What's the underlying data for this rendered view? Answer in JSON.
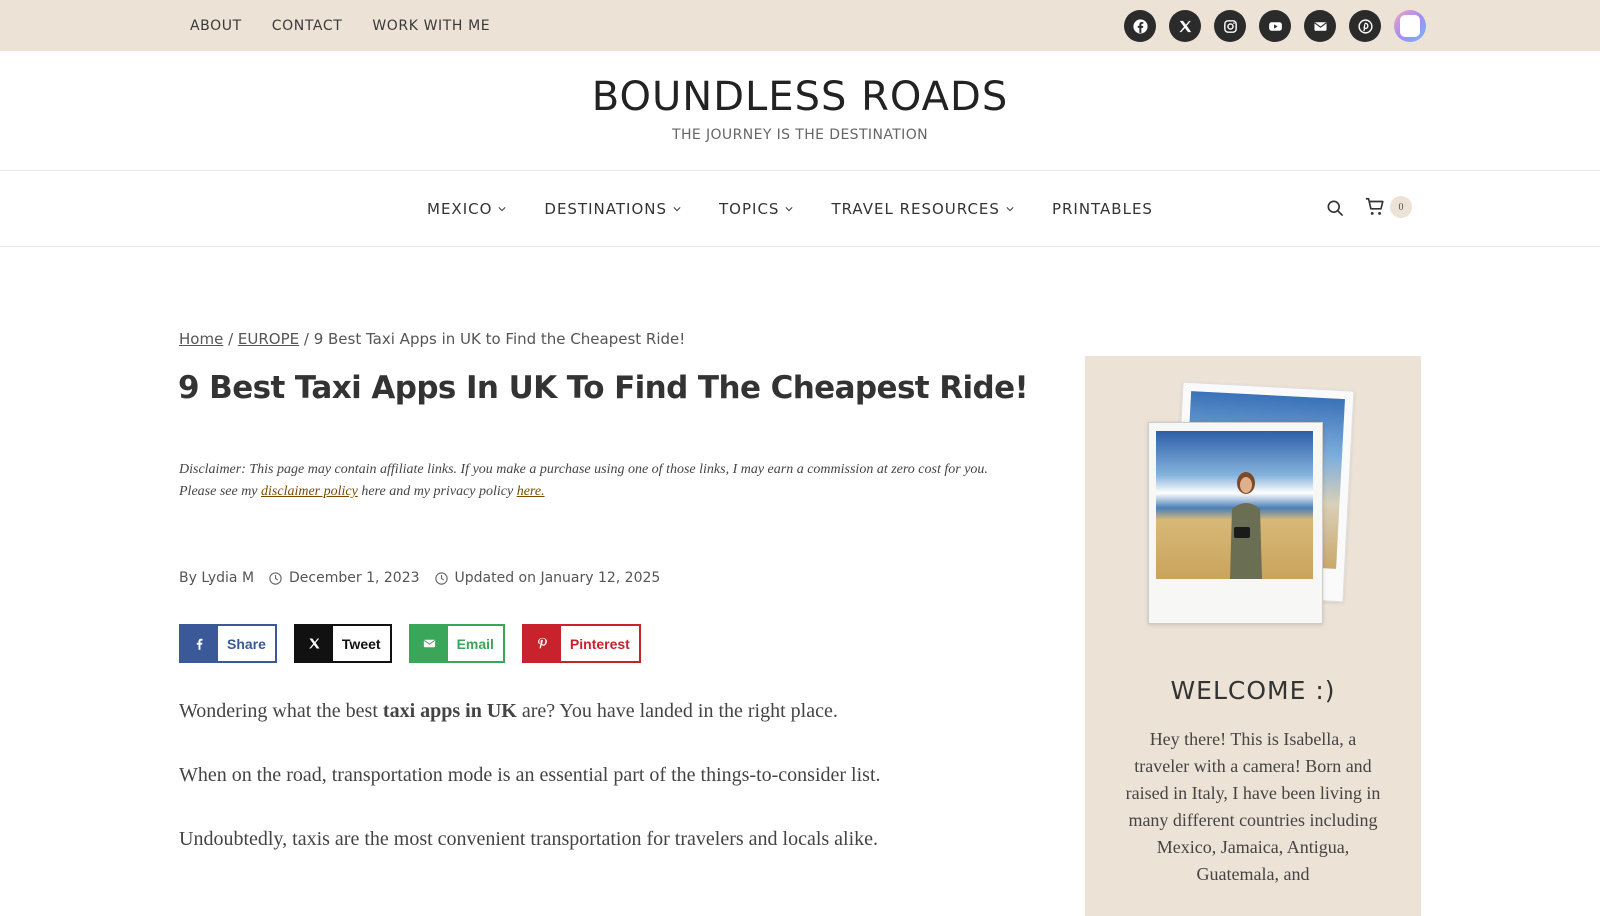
{
  "topbar": {
    "links": [
      "ABOUT",
      "CONTACT",
      "WORK WITH ME"
    ],
    "social_icons": [
      "facebook-icon",
      "x-icon",
      "instagram-icon",
      "youtube-icon",
      "email-icon",
      "pinterest-icon",
      "substack-icon"
    ]
  },
  "header": {
    "brand": "BOUNDLESS ROADS",
    "tagline": "THE JOURNEY IS THE DESTINATION"
  },
  "nav": {
    "items": [
      {
        "label": "MEXICO",
        "has_dropdown": true
      },
      {
        "label": "DESTINATIONS",
        "has_dropdown": true
      },
      {
        "label": "TOPICS",
        "has_dropdown": true
      },
      {
        "label": "TRAVEL RESOURCES",
        "has_dropdown": true
      },
      {
        "label": "PRINTABLES",
        "has_dropdown": false
      }
    ],
    "cart_count": "0"
  },
  "breadcrumb": {
    "home": "Home",
    "sep1": " / ",
    "category": "EUROPE",
    "sep2": " / ",
    "current": "9 Best Taxi Apps in UK to Find the Cheapest Ride!"
  },
  "article": {
    "title": "9 Best Taxi Apps In UK To Find The Cheapest Ride!",
    "disclaimer": {
      "text1": "Disclaimer: This page may contain affiliate links. If you make a purchase using one of those links, I may earn a commission at zero cost for you. Please see my ",
      "link1": "disclaimer policy",
      "text2": " here and my privacy policy ",
      "link2": "here."
    },
    "meta": {
      "by": "By Lydia M",
      "published": "December 1, 2023",
      "updated": "Updated on January 12, 2025"
    },
    "share_buttons": [
      {
        "label": "Share",
        "icon": "facebook-icon"
      },
      {
        "label": "Tweet",
        "icon": "x-icon"
      },
      {
        "label": "Email",
        "icon": "email-icon"
      },
      {
        "label": "Pinterest",
        "icon": "pinterest-icon"
      }
    ],
    "paragraphs": {
      "p1_before": "Wondering what the best ",
      "p1_bold": "taxi apps in UK",
      "p1_after": " are? You have landed in the right place.",
      "p2": "When on the road, transportation mode is an essential part of the things-to-consider list.",
      "p3": "Undoubtedly, taxis are the most convenient transportation for travelers and locals alike."
    }
  },
  "sidebar": {
    "heading": "WELCOME :)",
    "bio": "Hey there! This is Isabella, a traveler with a camera! Born and raised in Italy, I have been living in many different countries including Mexico, Jamaica, Antigua, Guatemala, and"
  },
  "colors": {
    "topbar_bg": "#ede2d6",
    "facebook": "#3b5998",
    "x": "#111111",
    "email": "#3aa65a",
    "pinterest": "#c8232c"
  }
}
